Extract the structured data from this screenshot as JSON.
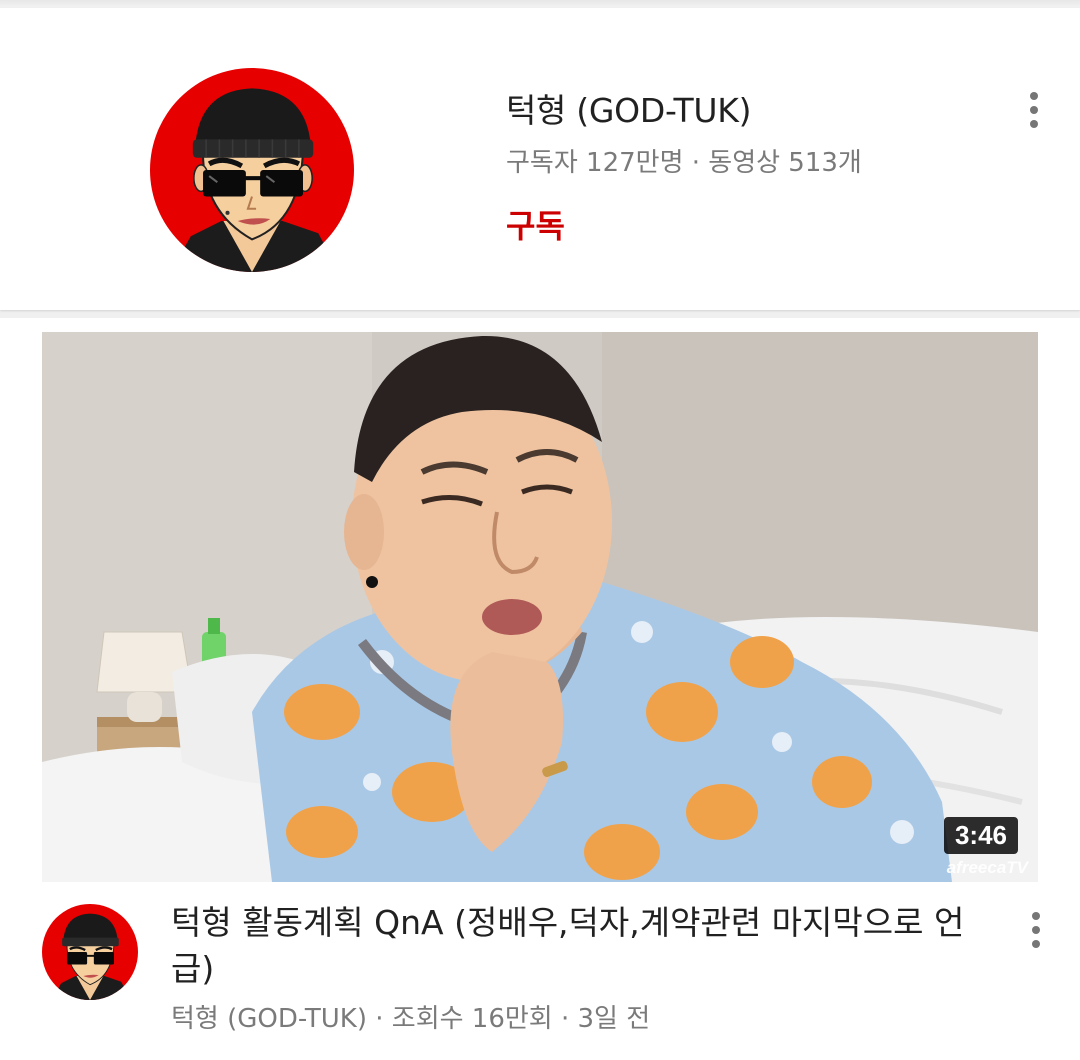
{
  "channel": {
    "name": "턱형 (GOD-TUK)",
    "stats": "구독자 127만명 · 동영상 513개",
    "subscribe_label": "구독",
    "menu_icon": "more-vert-icon"
  },
  "video": {
    "duration": "3:46",
    "watermark": "afreecaTV",
    "title": "턱형 활동계획 QnA (정배우,덕자,계약관련 마지막으로 언급)",
    "meta": "턱형 (GOD-TUK) · 조회수 16만회 · 3일 전",
    "menu_icon": "more-vert-icon"
  },
  "colors": {
    "accent_red": "#cc0000",
    "avatar_bg": "#e60000",
    "text_primary": "#212121",
    "text_secondary": "#7a7a7a"
  }
}
